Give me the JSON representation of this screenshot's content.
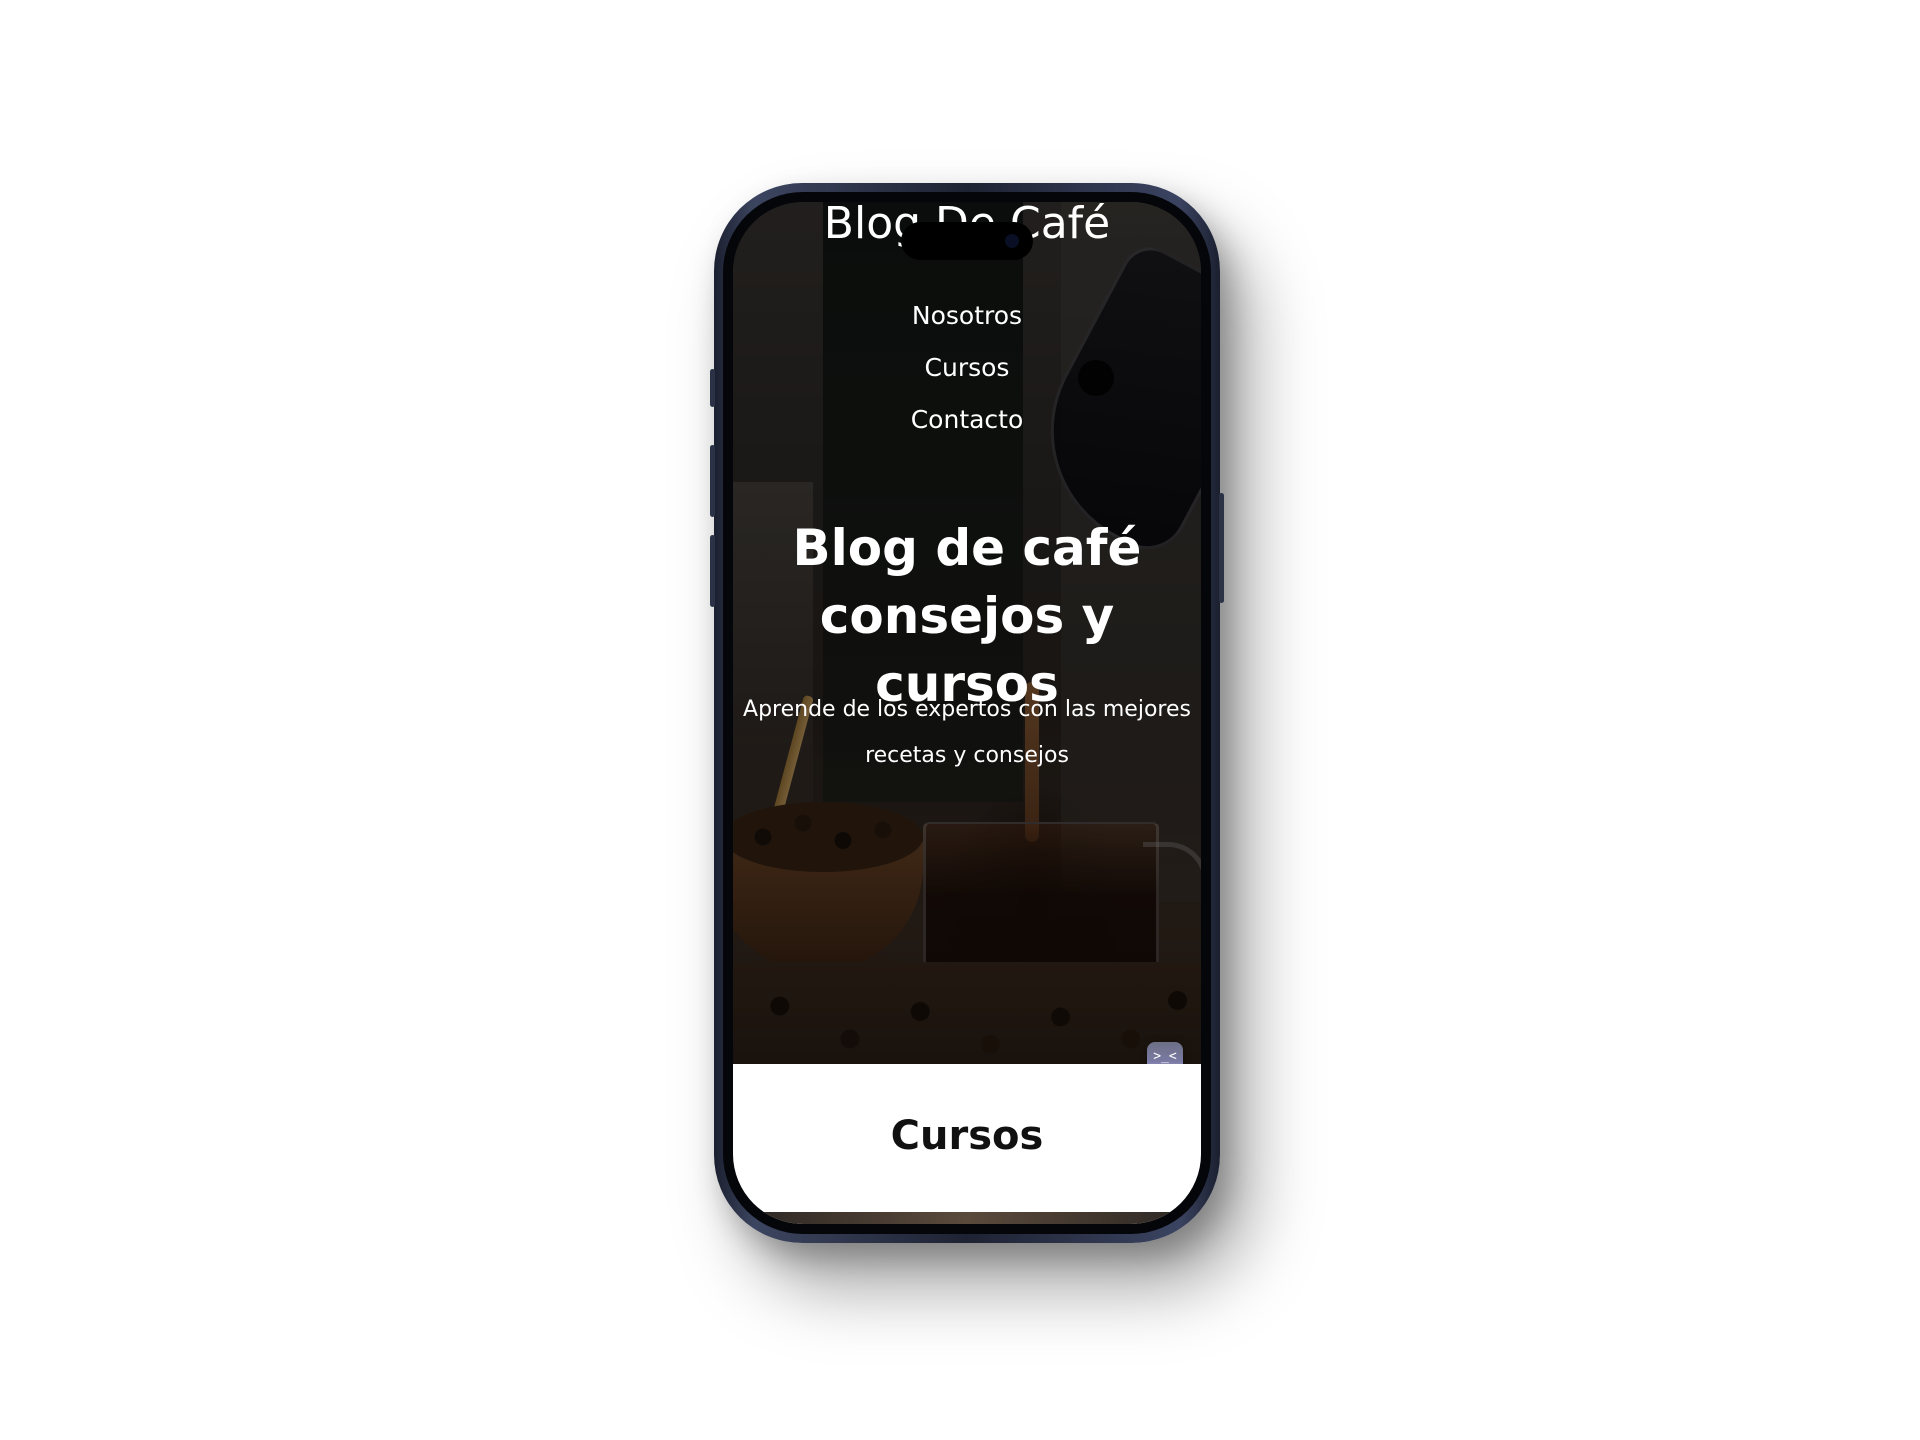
{
  "site": {
    "title": "Blog De Café"
  },
  "nav": {
    "items": [
      {
        "label": "Nosotros"
      },
      {
        "label": "Cursos"
      },
      {
        "label": "Contacto"
      }
    ]
  },
  "hero": {
    "title": "Blog de café consejos y cursos",
    "subtitle": "Aprende de los expertos con las mejores recetas y consejos"
  },
  "widget": {
    "glyph": ">_<"
  },
  "courses": {
    "heading": "Cursos"
  },
  "colors": {
    "page_background": "#ffffff",
    "phone_frame": "#1e2333",
    "text_light": "#ffffff",
    "text_dark": "#111111"
  }
}
